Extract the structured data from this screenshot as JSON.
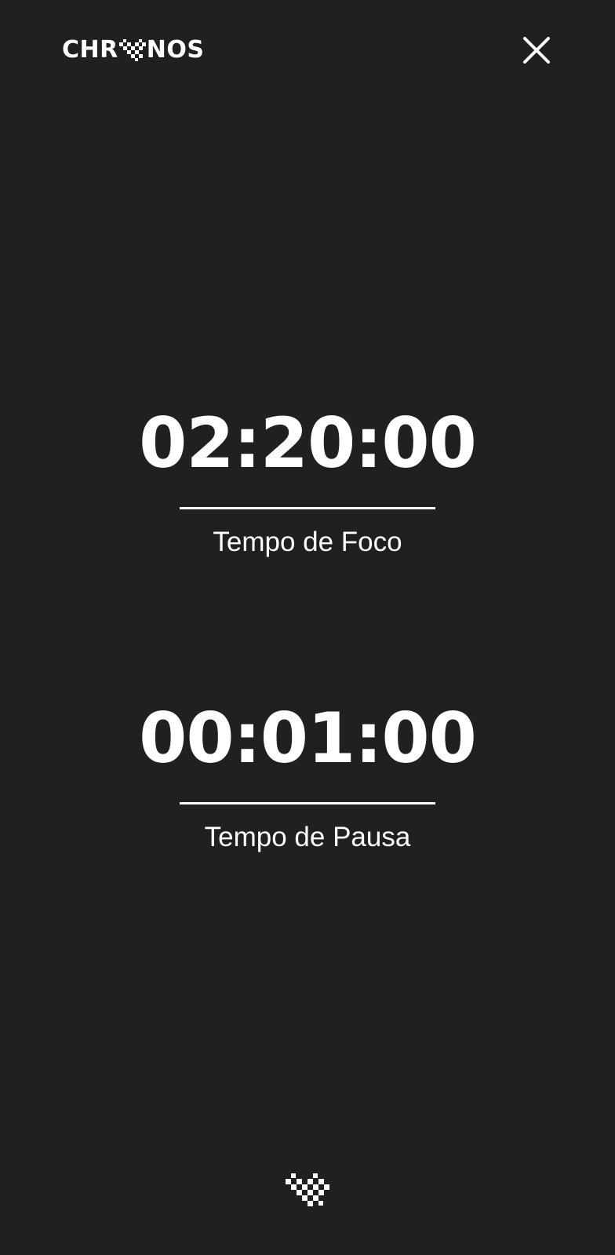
{
  "header": {
    "logo_prefix": "CHR",
    "logo_suffix": "NOS",
    "logo_icon": "chronos-mark-icon",
    "close_icon": "close-icon"
  },
  "focus": {
    "time": "02:20:00",
    "label": "Tempo de Foco"
  },
  "pause": {
    "time": "00:01:00",
    "label": "Tempo de Pausa"
  },
  "footer": {
    "icon": "chronos-mark-icon"
  },
  "colors": {
    "background": "#202020",
    "foreground": "#ffffff"
  }
}
